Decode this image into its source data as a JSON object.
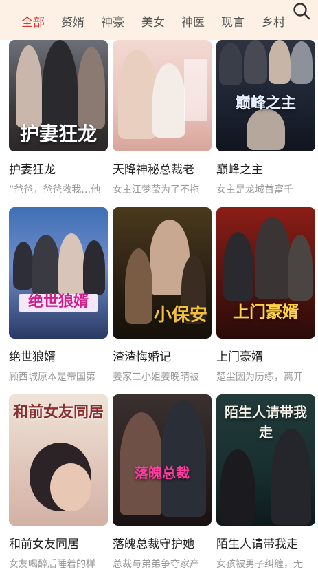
{
  "header": {
    "tabs": [
      {
        "label": "全部",
        "active": true
      },
      {
        "label": "赘婿"
      },
      {
        "label": "神豪"
      },
      {
        "label": "美女"
      },
      {
        "label": "神医"
      },
      {
        "label": "现言"
      },
      {
        "label": "乡村"
      }
    ],
    "search_icon": "search-icon"
  },
  "dramas": [
    {
      "title": "护妻狂龙",
      "desc": "“爸爸，爸爸救我…他",
      "poster_text": "护妻狂龙"
    },
    {
      "title": "天降神秘总裁老",
      "desc": "女主江梦莹为了不拖",
      "poster_text": ""
    },
    {
      "title": "巅峰之主",
      "desc": "女主是龙城首富千",
      "poster_text": "巅峰之主"
    },
    {
      "title": "绝世狼婿",
      "desc": "顾西城原本是帝国第",
      "poster_text": "绝世狼婿"
    },
    {
      "title": "渣渣悔婚记",
      "desc": "姜家二小姐姜晚晴被",
      "poster_text": "小保安"
    },
    {
      "title": "上门豪婿",
      "desc": "楚尘因为历练，离开",
      "poster_text": "上门豪婿"
    },
    {
      "title": "和前女友同居",
      "desc": "女友喝醉后睡着的样",
      "poster_text": "和前女友同居"
    },
    {
      "title": "落魄总裁守护她",
      "desc": "总裁与弟弟争夺家产",
      "poster_text": "落魄总裁"
    },
    {
      "title": "陌生人请带我走",
      "desc": "女孩被男子纠缠，无",
      "poster_text": "陌生人请带我走"
    }
  ],
  "colors": {
    "accent": "#e1373b",
    "topbar_bg": "#fdf1e6"
  }
}
